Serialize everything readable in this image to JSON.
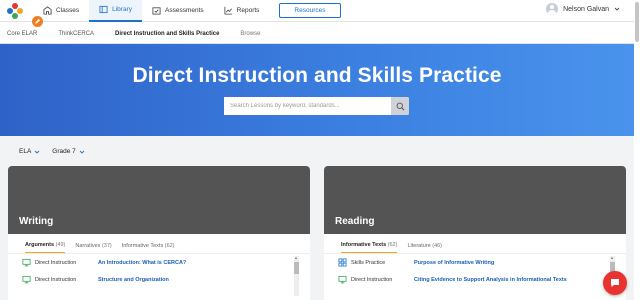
{
  "nav": {
    "items": [
      {
        "label": "Classes",
        "icon": "classes-icon"
      },
      {
        "label": "Library",
        "icon": "library-icon",
        "active": true
      },
      {
        "label": "Assessments",
        "icon": "assessments-icon"
      },
      {
        "label": "Reports",
        "icon": "reports-icon"
      }
    ],
    "resources_label": "Resources",
    "user_name": "Nelson Galvan"
  },
  "subnav": {
    "items": [
      "Core ELAR",
      "ThinkCERCA",
      "Direct Instruction and Skills Practice",
      "Browse"
    ]
  },
  "hero": {
    "title": "Direct Instruction and Skills Practice",
    "search_placeholder": "Search Lessons by keyword, standards..."
  },
  "filters": {
    "subject": "ELA",
    "grade": "Grade 7"
  },
  "cards": [
    {
      "title": "Writing",
      "tabs": [
        {
          "label": "Arguments",
          "count": "(49)",
          "active": true
        },
        {
          "label": "Narratives",
          "count": "(37)"
        },
        {
          "label": "Informative Texts",
          "count": "(62)"
        }
      ],
      "rows": [
        {
          "type": "Direct Instruction",
          "name": "An Introduction: What is CERCA?",
          "icon": "monitor-icon"
        },
        {
          "type": "Direct Instruction",
          "name": "Structure and Organization",
          "icon": "monitor-icon"
        }
      ]
    },
    {
      "title": "Reading",
      "tabs": [
        {
          "label": "Informative Texts",
          "count": "(62)",
          "active": true
        },
        {
          "label": "Literature",
          "count": "(46)"
        }
      ],
      "rows": [
        {
          "type": "Skills Practice",
          "name": "Purpose of Informative Writing",
          "icon": "grid-icon"
        },
        {
          "type": "Direct Instruction",
          "name": "Citing Evidence to Support Analysis in Informational Texts",
          "icon": "monitor-icon"
        }
      ]
    }
  ],
  "colors": {
    "accent": "#1a73c8",
    "hero_start": "#2f62c7",
    "hero_end": "#4a93ec",
    "card_header": "#545454",
    "tab_underline": "#f2a51f",
    "chat": "#e8332e"
  }
}
